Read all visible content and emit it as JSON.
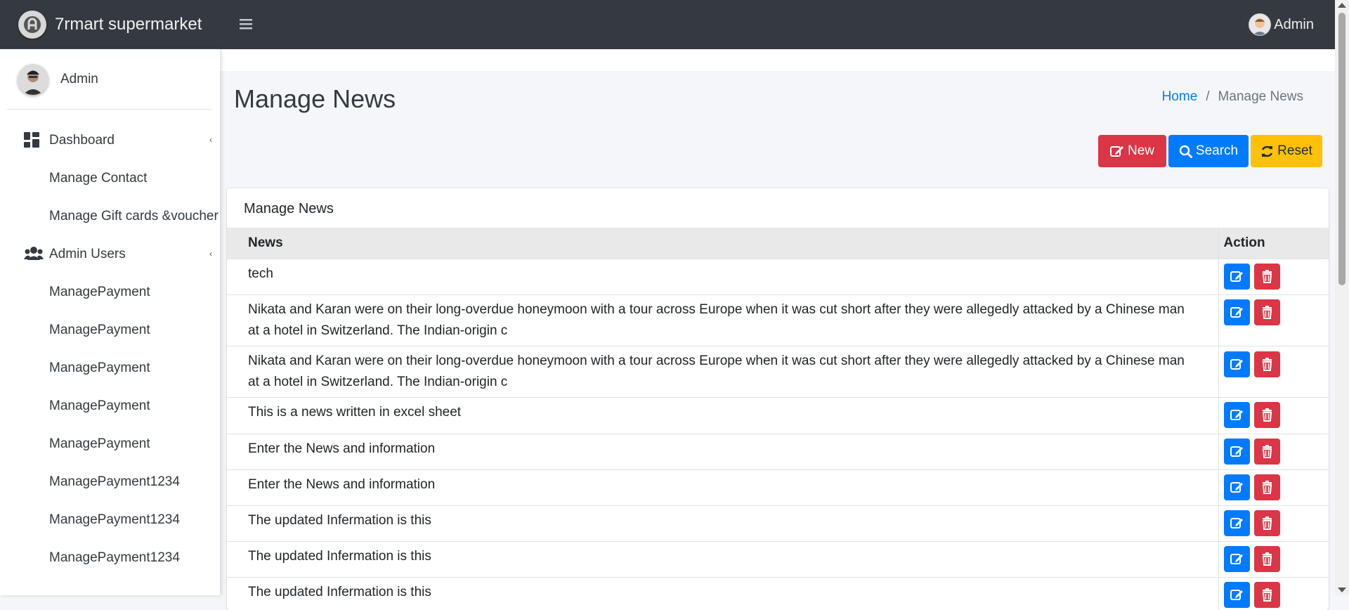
{
  "brand": {
    "name": "7rmart supermarket"
  },
  "topbar": {
    "user_name": "Admin"
  },
  "sidebar": {
    "user_name": "Admin",
    "items": [
      {
        "label": "Dashboard",
        "icon": "dashboard-icon",
        "has_caret": true
      },
      {
        "label": "Manage Contact"
      },
      {
        "label": "Manage Gift cards &voucher"
      },
      {
        "label": "Admin Users",
        "icon": "users-icon",
        "has_caret": true
      },
      {
        "label": "ManagePayment"
      },
      {
        "label": "ManagePayment"
      },
      {
        "label": "ManagePayment"
      },
      {
        "label": "ManagePayment"
      },
      {
        "label": "ManagePayment"
      },
      {
        "label": "ManagePayment1234"
      },
      {
        "label": "ManagePayment1234"
      },
      {
        "label": "ManagePayment1234"
      }
    ]
  },
  "page": {
    "title": "Manage News",
    "breadcrumb": {
      "home": "Home",
      "separator": "/",
      "current": "Manage News"
    }
  },
  "toolbar": {
    "new_label": "New",
    "search_label": "Search",
    "reset_label": "Reset"
  },
  "table": {
    "card_title": "Manage News",
    "headers": {
      "news": "News",
      "action": "Action"
    },
    "rows": [
      "tech",
      "Nikata and Karan were on their long-overdue honeymoon with a tour across Europe when it was cut short after they were allegedly attacked by a Chinese man at a hotel in Switzerland. The Indian-origin c",
      "Nikata and Karan were on their long-overdue honeymoon with a tour across Europe when it was cut short after they were allegedly attacked by a Chinese man at a hotel in Switzerland. The Indian-origin c",
      "This is a news written in excel sheet",
      "Enter the News and information",
      "Enter the News and information",
      "The updated Infermation is this",
      "The updated Infermation is this",
      "The updated Infermation is this"
    ]
  },
  "colors": {
    "navbar": "#343a40",
    "danger": "#dc3545",
    "primary": "#007bff",
    "warning": "#ffc107"
  }
}
